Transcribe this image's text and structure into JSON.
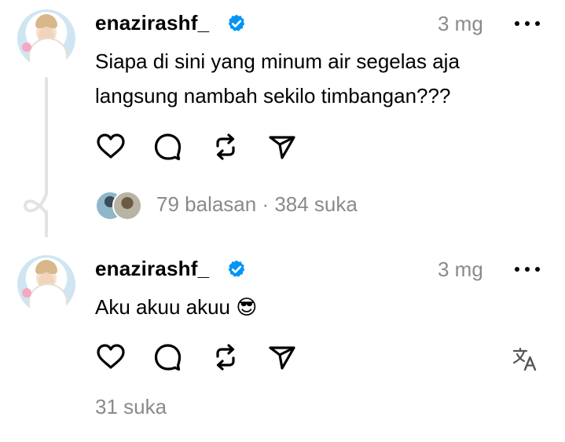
{
  "posts": [
    {
      "username": "enazirashf_",
      "time": "3 mg",
      "text_lines": [
        "Siapa di sini yang minum air segelas aja",
        "langsung nambah sekilo timbangan???"
      ],
      "stats": "79 balasan · 384 suka",
      "icons": [
        "heart-icon",
        "comment-icon",
        "repost-icon",
        "share-icon",
        "verified-badge-icon",
        "more-icon"
      ]
    },
    {
      "username": "enazirashf_",
      "time": "3 mg",
      "text": "Aku akuu akuu",
      "emoji": "😎",
      "likes": "31 suka",
      "icons": [
        "heart-icon",
        "comment-icon",
        "repost-icon",
        "share-icon",
        "translate-icon",
        "verified-badge-icon",
        "more-icon"
      ]
    }
  ],
  "colors": {
    "text": "#000000",
    "muted": "#8a8a8a",
    "verified": "#0095f6",
    "thread_line": "#e3e3e3",
    "background": "#ffffff"
  }
}
